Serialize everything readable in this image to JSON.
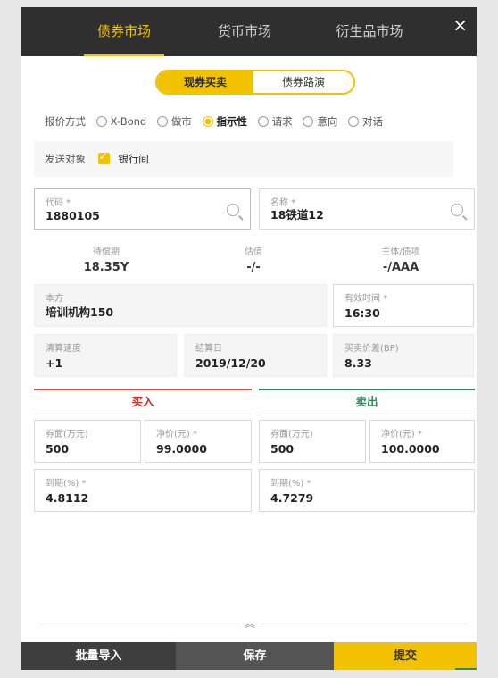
{
  "tabs": [
    {
      "label": "债券市场"
    },
    {
      "label": "货币市场"
    },
    {
      "label": "衍生品市场"
    }
  ],
  "close_symbol": "×",
  "segment": {
    "spot": "现券买卖",
    "roadshow": "债券路演"
  },
  "quote_mode": {
    "label": "报价方式",
    "options": [
      "X-Bond",
      "做市",
      "指示性",
      "请求",
      "意向",
      "对话"
    ],
    "selected": "指示性"
  },
  "send_target": {
    "label": "发送对象",
    "option": "银行间",
    "checked": true
  },
  "code": {
    "caption": "代码 *",
    "value": "1880105"
  },
  "name": {
    "caption": "名称 *",
    "value": "18铁道12"
  },
  "stats": {
    "remaining_caption": "待偿期",
    "remaining_value": "18.35Y",
    "valuation_caption": "估值",
    "valuation_value": "-/-",
    "rating_caption": "主体/债项",
    "rating_value": "-/AAA"
  },
  "party": {
    "caption": "本方",
    "value": "培训机构150"
  },
  "valid_time": {
    "caption": "有效时间 *",
    "value": "16:30"
  },
  "clearing_speed": {
    "caption": "清算速度",
    "value": "+1"
  },
  "settle_date": {
    "caption": "结算日",
    "value": "2019/12/20"
  },
  "spread": {
    "caption": "买卖价差(BP)",
    "value": "8.33"
  },
  "buy": {
    "title": "买入",
    "face_caption": "券面(万元)",
    "face_value": "500",
    "price_caption": "净价(元) *",
    "price_value": "99.0000",
    "yield_caption": "到期(%) *",
    "yield_value": "4.8112"
  },
  "sell": {
    "title": "卖出",
    "face_caption": "券面(万元)",
    "face_value": "500",
    "price_caption": "净价(元) *",
    "price_value": "100.0000",
    "yield_caption": "到期(%) *",
    "yield_value": "4.7279"
  },
  "collapse_symbol": "︽",
  "bottom": {
    "import": "批量导入",
    "save": "保存",
    "submit": "提交"
  },
  "colors": {
    "accent": "#f2c200",
    "topbar": "#2f2f2f",
    "buy": "#c9302c",
    "sell": "#2e8b57"
  }
}
